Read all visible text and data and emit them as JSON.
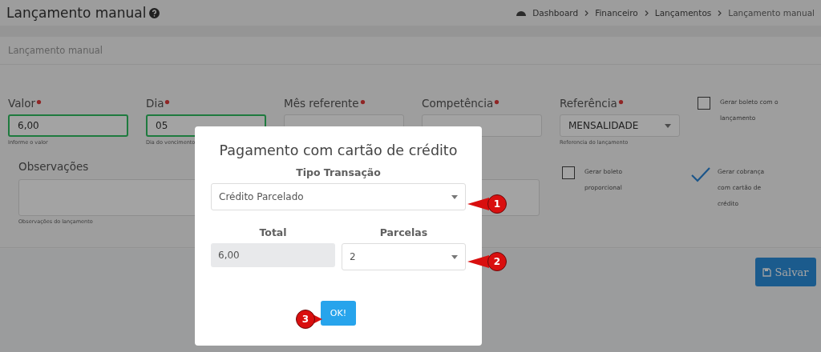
{
  "header": {
    "title": "Lançamento manual",
    "breadcrumb": [
      {
        "label": "Dashboard",
        "kind": "home"
      },
      {
        "label": "Financeiro",
        "kind": "link"
      },
      {
        "label": "Lançamentos",
        "kind": "link"
      },
      {
        "label": "Lançamento manual",
        "kind": "current"
      }
    ]
  },
  "card": {
    "title": "Lançamento manual",
    "fields": [
      {
        "label": "Valor",
        "required": true,
        "valid": true,
        "kind": "input",
        "value": "6,00",
        "hint": "Informe o valor"
      },
      {
        "label": "Dia",
        "required": true,
        "valid": true,
        "kind": "input",
        "value": "05",
        "hint": "Dia do vencimento"
      },
      {
        "label": "Mês referente",
        "required": true,
        "valid": false,
        "kind": "input"
      },
      {
        "label": "Competência",
        "required": true,
        "valid": false,
        "kind": "input"
      },
      {
        "label": "Referência",
        "required": true,
        "valid": false,
        "kind": "select",
        "value": "MENSALIDADE",
        "hint": "Referencia do lançamento"
      }
    ],
    "notes": {
      "label": "Observações",
      "hint": "Observações do lançamento"
    },
    "options": [
      {
        "label": "Gerar boleto com o lançamento",
        "checked": false
      },
      {
        "label": "Gerar boleto proporcional",
        "checked": false
      },
      {
        "label": "Gerar cobrança com cartão de crédito",
        "checked": true
      }
    ],
    "save_button": "Salvar"
  },
  "modal": {
    "title": "Pagamento com cartão de crédito",
    "type_label": "Tipo Transação",
    "type_value": "Crédito Parcelado",
    "total_label": "Total",
    "total_value": "6,00",
    "installments_label": "Parcelas",
    "installments_value": "2",
    "ok_button": "OK!"
  },
  "markers": [
    "1",
    "2",
    "3"
  ]
}
